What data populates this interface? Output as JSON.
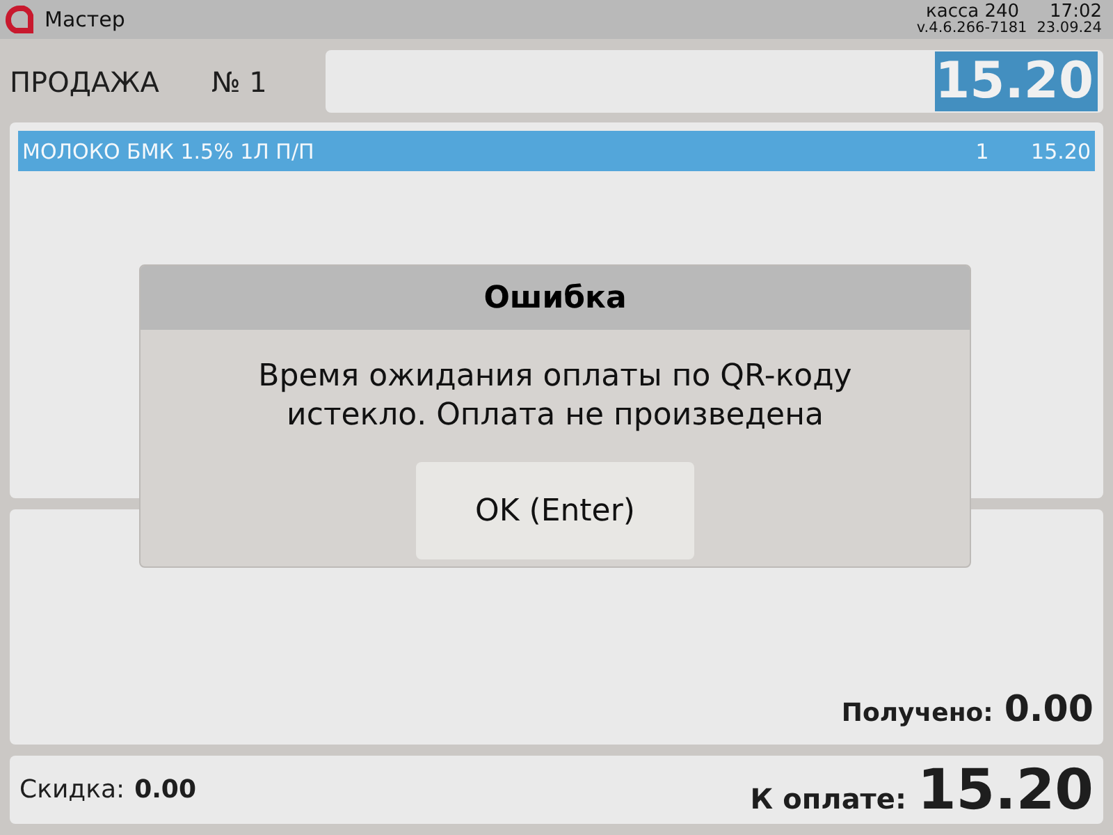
{
  "top_bar": {
    "app_name": "Мастер",
    "register": "касса 240",
    "time": "17:02",
    "version": "v.4.6.266-7181",
    "date": "23.09.24"
  },
  "header": {
    "title": "ПРОДАЖА",
    "receipt_number": "№ 1",
    "display_total": "15.20"
  },
  "items": [
    {
      "name": "МОЛОКО БМК 1.5% 1Л П/П",
      "quantity": "1",
      "price": "15.20",
      "selected": true
    }
  ],
  "received": {
    "label": "Получено:",
    "value": "0.00"
  },
  "footer": {
    "discount_label": "Скидка:",
    "discount_value": "0.00",
    "due_label": "К оплате:",
    "due_value": "15.20"
  },
  "dialog": {
    "title": "Ошибка",
    "message": "Время ожидания оплаты по QR-коду истекло. Оплата не произведена",
    "button": "OK (Enter)"
  }
}
